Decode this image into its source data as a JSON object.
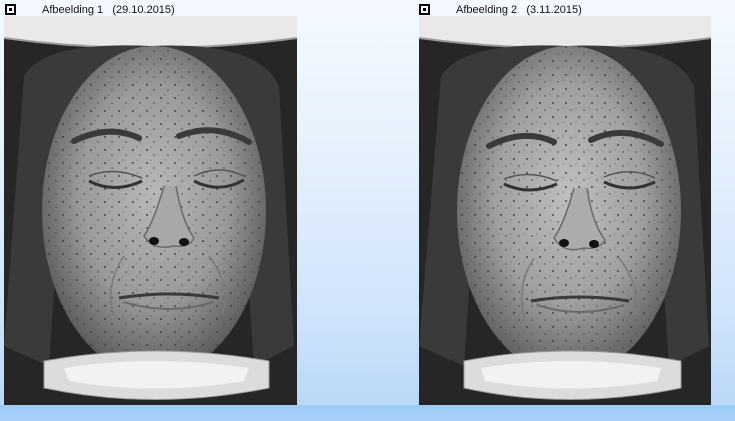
{
  "panels": [
    {
      "title": "Afbeelding 1   (29.10.2015)",
      "icon": "window-maximize-icon"
    },
    {
      "title": "Afbeelding 2   (3.11.2015)",
      "icon": "window-maximize-icon"
    }
  ],
  "colors": {
    "background_top": "#f4f9ff",
    "background_bottom": "#b6d6f7",
    "bottom_strip": "#9ccbf7"
  }
}
